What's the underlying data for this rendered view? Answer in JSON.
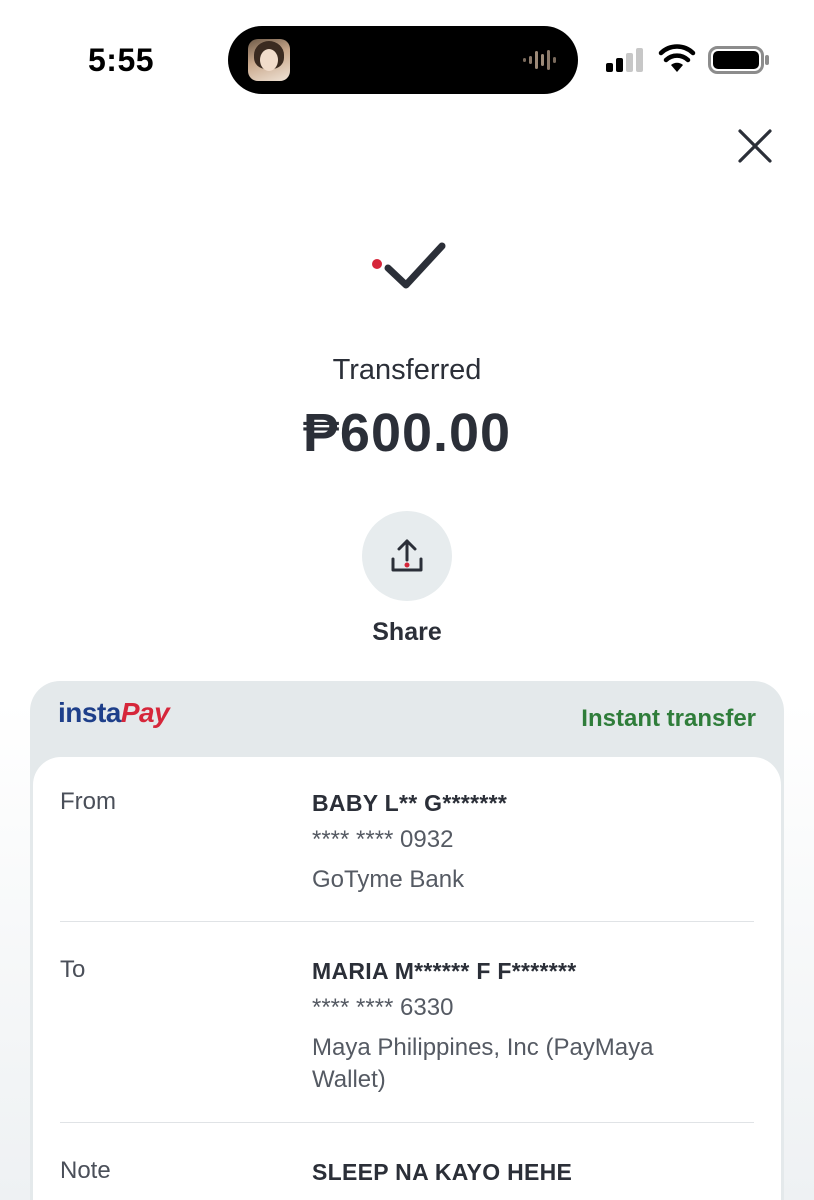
{
  "status_bar": {
    "time": "5:55"
  },
  "result": {
    "status_label": "Transferred",
    "amount": "₱600.00"
  },
  "share": {
    "label": "Share"
  },
  "card": {
    "logo_part_1": "insta",
    "logo_part_2": "Pay",
    "transfer_type": "Instant transfer",
    "from": {
      "label": "From",
      "name": "BABY L** G*******",
      "account": "**** **** 0932",
      "bank": "GoTyme Bank"
    },
    "to": {
      "label": "To",
      "name": "MARIA M****** F F*******",
      "account": "**** **** 6330",
      "bank": "Maya Philippines, Inc (PayMaya Wallet)"
    },
    "note": {
      "label": "Note",
      "value": "SLEEP NA KAYO HEHE"
    }
  },
  "colors": {
    "accent_red": "#d6263a",
    "instapay_blue": "#1e3f8a",
    "instant_green": "#2f7d3a",
    "text_dark": "#2b2f38"
  },
  "icons": {
    "close": "close-icon",
    "check": "checkmark-icon",
    "share": "share-upload-icon"
  }
}
